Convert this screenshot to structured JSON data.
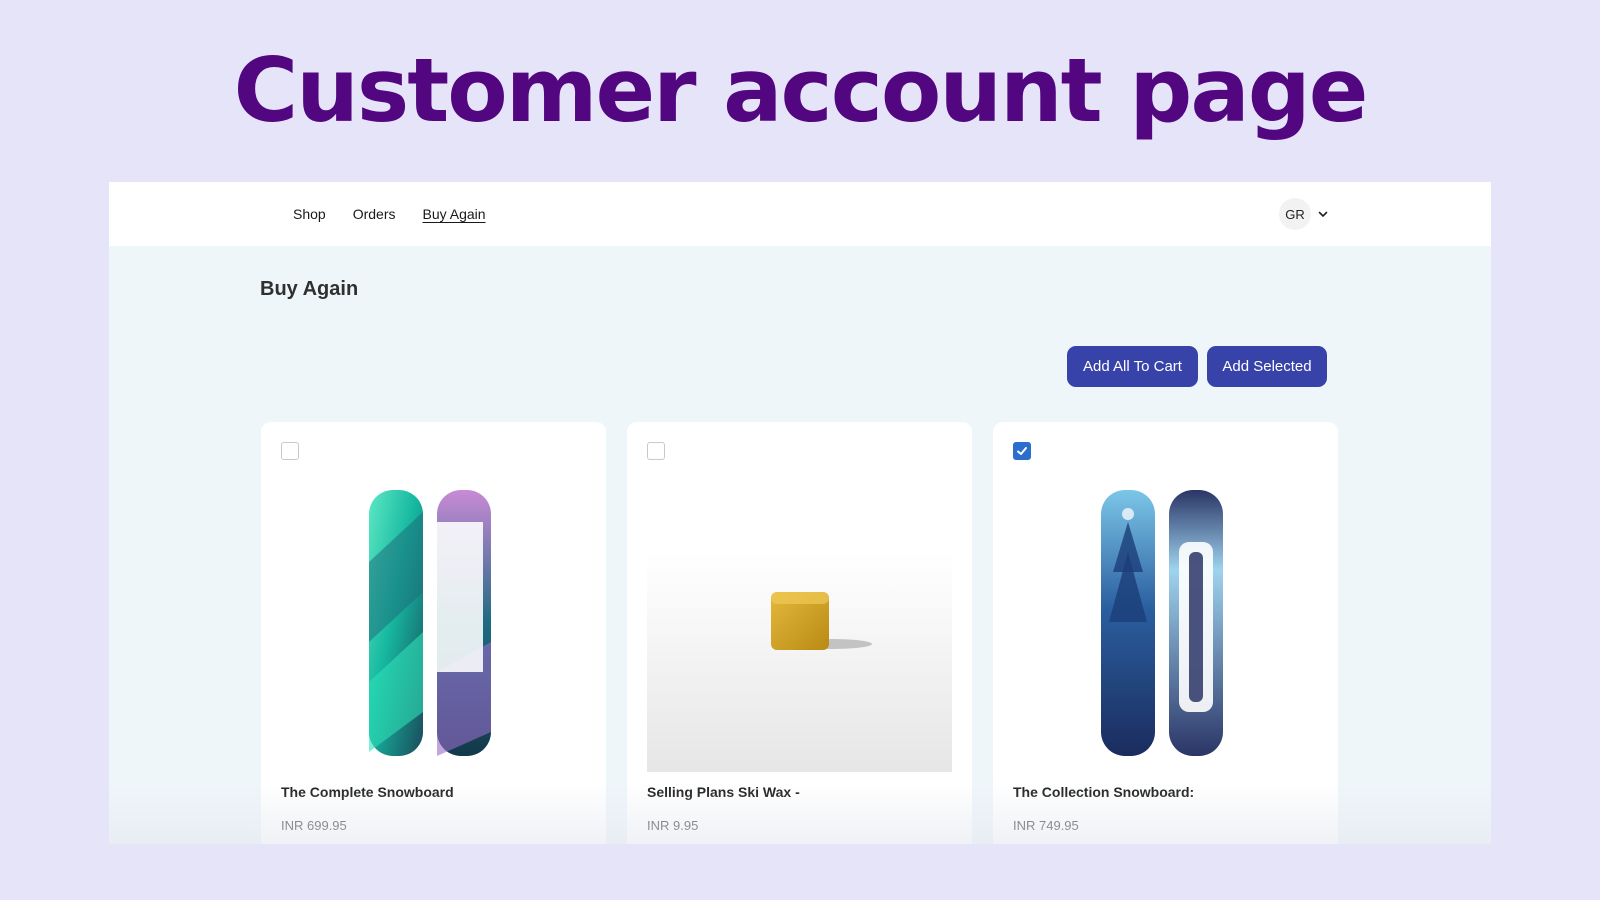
{
  "hero": {
    "title": "Customer account page"
  },
  "nav": {
    "items": [
      "Shop",
      "Orders",
      "Buy Again"
    ],
    "active": "Buy Again"
  },
  "account": {
    "initials": "GR",
    "icon": "chevron-down-icon"
  },
  "page": {
    "title": "Buy Again"
  },
  "actions": {
    "add_all": "Add All To Cart",
    "add_selected": "Add Selected"
  },
  "products": [
    {
      "name": "The Complete Snowboard",
      "price": "INR 699.95",
      "checked": false,
      "image": "snowboard-image"
    },
    {
      "name": "Selling Plans Ski Wax -",
      "price": "INR 9.95",
      "checked": false,
      "image": "ski-wax-image"
    },
    {
      "name": "The Collection Snowboard:",
      "price": "INR 749.95",
      "checked": true,
      "image": "snowboard-image"
    }
  ],
  "colors": {
    "accent": "#3743a9",
    "hero": "#52067f",
    "checkbox": "#2c6ecb",
    "background": "#e5e4f8"
  }
}
